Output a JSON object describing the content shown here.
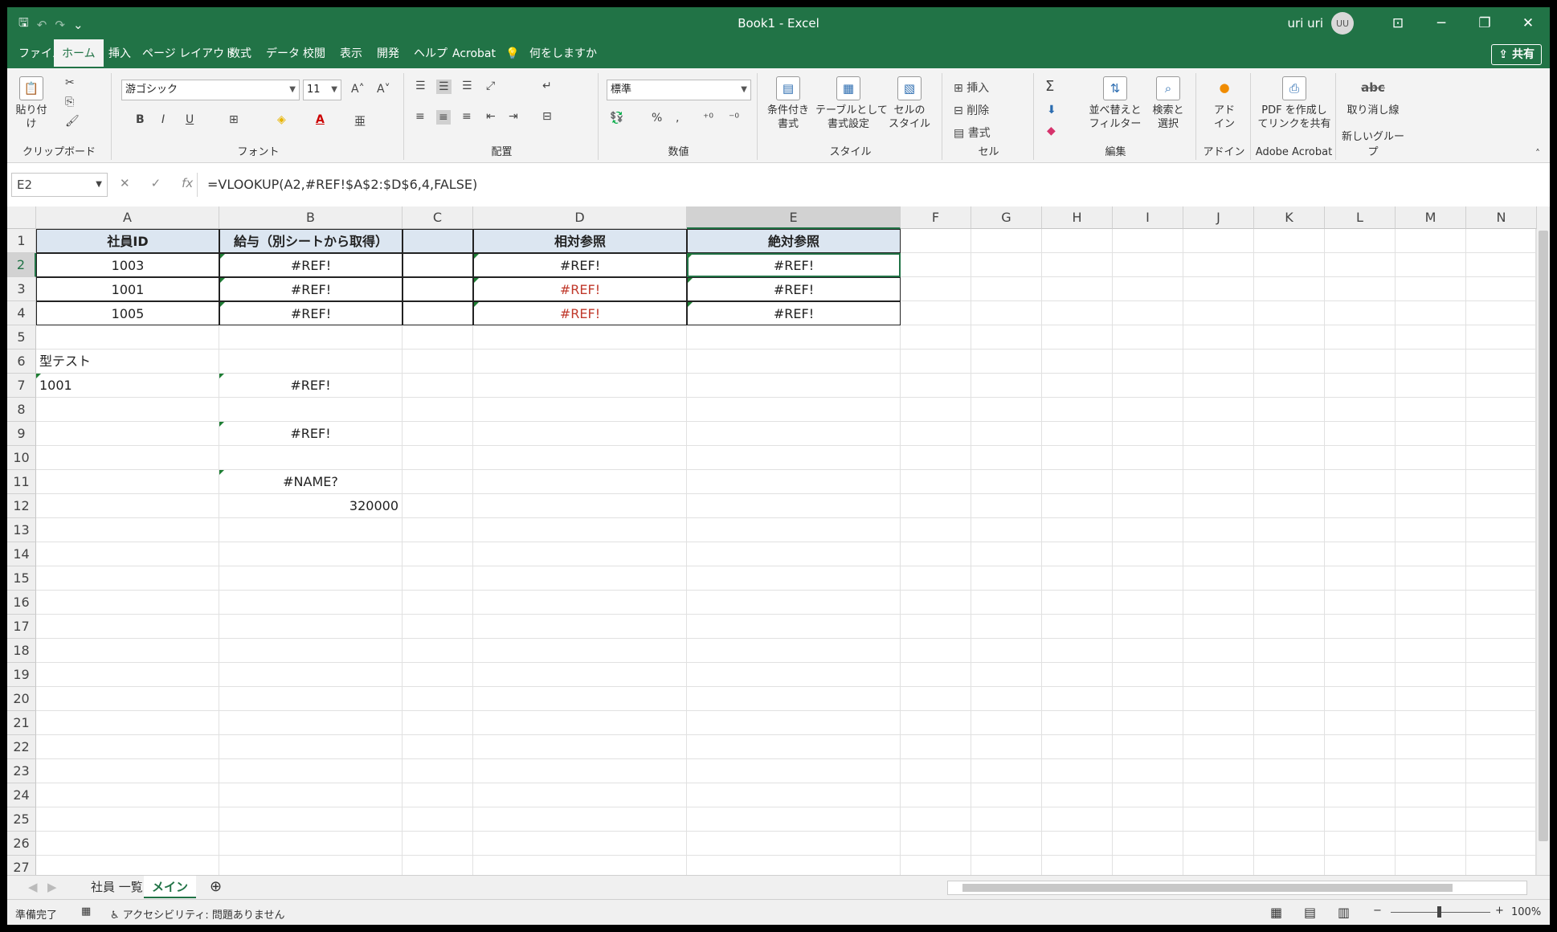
{
  "window": {
    "title": "Book1  -  Excel",
    "user": "uri uri",
    "avatar": "UU"
  },
  "quickaccess": {
    "save": "🖫",
    "undo": "↶",
    "redo": "↷",
    "more": "⌄"
  },
  "menu": [
    "ファイル",
    "ホーム",
    "挿入",
    "ページ レイアウト",
    "数式",
    "データ",
    "校閲",
    "表示",
    "開発",
    "ヘルプ",
    "Acrobat",
    "何をしますか"
  ],
  "share": "共有",
  "ribbon": {
    "clipboard": {
      "paste": "貼り付け",
      "label": "クリップボード"
    },
    "font": {
      "name": "游ゴシック",
      "size": "11",
      "label": "フォント",
      "bold": "B",
      "italic": "I",
      "underline": "U"
    },
    "align": {
      "label": "配置"
    },
    "number": {
      "format": "標準",
      "label": "数値",
      "percent": "%",
      "comma": ","
    },
    "styles": {
      "cond": "条件付き\n書式",
      "table": "テーブルとして\n書式設定",
      "cell": "セルの\nスタイル",
      "label": "スタイル"
    },
    "cells": {
      "insert": "挿入",
      "delete": "削除",
      "format": "書式",
      "label": "セル"
    },
    "edit": {
      "sort": "並べ替えと\nフィルター",
      "find": "検索と\n選択",
      "label": "編集",
      "sum": "Σ"
    },
    "addin": {
      "btn": "アド\nイン",
      "label": "アドイン"
    },
    "acrobat": {
      "btn": "PDF を作成し\nてリンクを共有",
      "label": "Adobe Acrobat"
    },
    "newgroup": {
      "btn": "取り消し線",
      "label": "新しいグループ",
      "icon": "abc"
    }
  },
  "formula_bar": {
    "name_box": "E2",
    "formula": "=VLOOKUP(A2,#REF!$A$2:$D$6,4,FALSE)"
  },
  "columns": [
    "A",
    "B",
    "C",
    "D",
    "E",
    "F",
    "G",
    "H",
    "I",
    "J",
    "K",
    "L",
    "M",
    "N"
  ],
  "rows": [
    "1",
    "2",
    "3",
    "4",
    "5",
    "6",
    "7",
    "8",
    "9",
    "10",
    "11",
    "12",
    "13",
    "14",
    "15",
    "16",
    "17",
    "18",
    "19",
    "20",
    "21",
    "22",
    "23",
    "24",
    "25",
    "26",
    "27"
  ],
  "cells": {
    "A1": "社員ID",
    "B1": "給与（別シートから取得）",
    "D1": "相対参照",
    "E1": "絶対参照",
    "A2": "1003",
    "B2": "#REF!",
    "D2": "#REF!",
    "E2": "#REF!",
    "A3": "1001",
    "B3": "#REF!",
    "D3": "#REF!",
    "E3": "#REF!",
    "A4": "1005",
    "B4": "#REF!",
    "D4": "#REF!",
    "E4": "#REF!",
    "A6": "型テスト",
    "A7": "1001",
    "B7": "#REF!",
    "B9": "#REF!",
    "B11": "#NAME?",
    "B12": "320000"
  },
  "sheets": [
    "社員 一覧",
    "メイン"
  ],
  "status": {
    "ready": "準備完了",
    "accessibility": "アクセシビリティ: 問題ありません",
    "zoom": "100%"
  },
  "colors": {
    "accent": "#217346",
    "header_fill": "#dce6f1",
    "error_red": "#c0392b"
  }
}
